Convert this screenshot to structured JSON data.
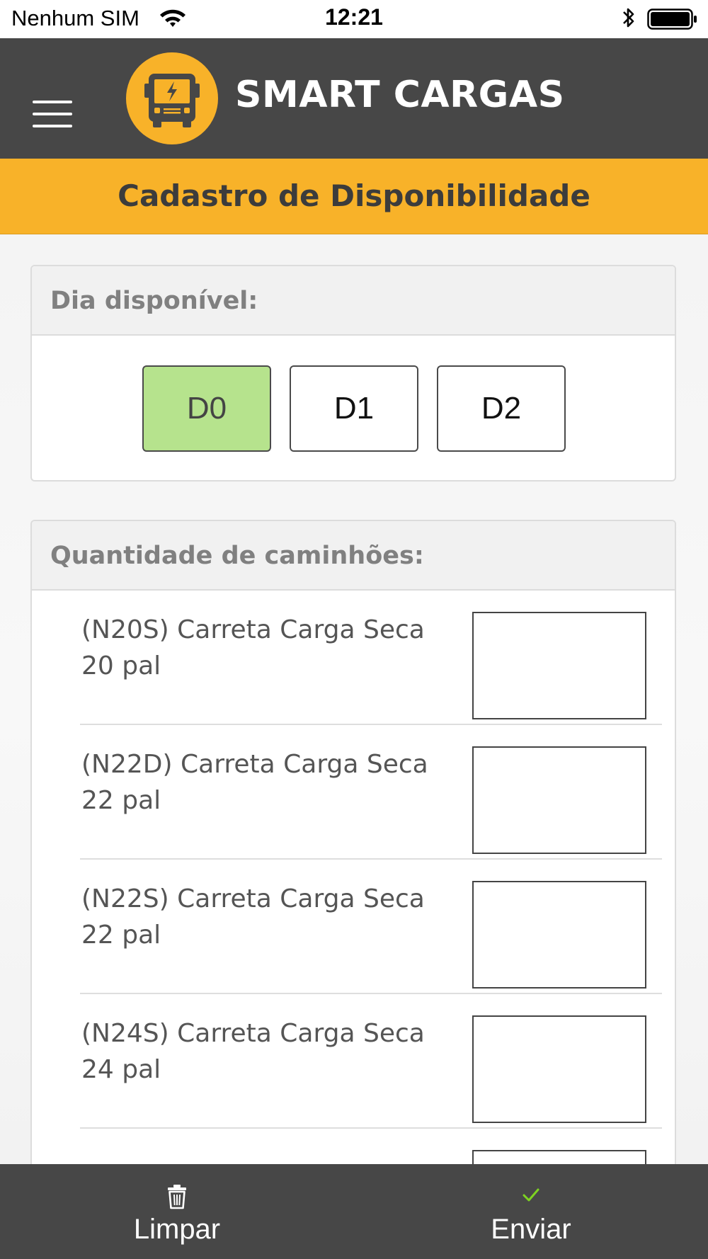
{
  "status_bar": {
    "carrier": "Nenhum SIM",
    "time": "12:21"
  },
  "header": {
    "app_title": "SMART CARGAS",
    "logo_icon": "truck-logo-icon",
    "menu_icon": "hamburger-menu-icon"
  },
  "page": {
    "title": "Cadastro de Disponibilidade"
  },
  "day_section": {
    "header": "Dia disponível:",
    "options": [
      "D0",
      "D1",
      "D2"
    ],
    "selected": "D0"
  },
  "trucks_section": {
    "header": "Quantidade de caminhões:",
    "items": [
      {
        "line1": "(N20S) Carreta Carga Seca",
        "line2": "20 pal",
        "value": ""
      },
      {
        "line1": "(N22D) Carreta Carga Seca",
        "line2": "22 pal",
        "value": ""
      },
      {
        "line1": "(N22S) Carreta Carga Seca",
        "line2": "22 pal",
        "value": ""
      },
      {
        "line1": "(N24S) Carreta Carga Seca",
        "line2": "24 pal",
        "value": ""
      }
    ]
  },
  "bottom_bar": {
    "clear_label": "Limpar",
    "clear_icon": "trash-icon",
    "send_label": "Enviar",
    "send_icon": "checkmark-icon"
  },
  "colors": {
    "header_bg": "#474747",
    "accent": "#f8b229",
    "selected_day": "#b6e38d",
    "check": "#7ed321"
  }
}
